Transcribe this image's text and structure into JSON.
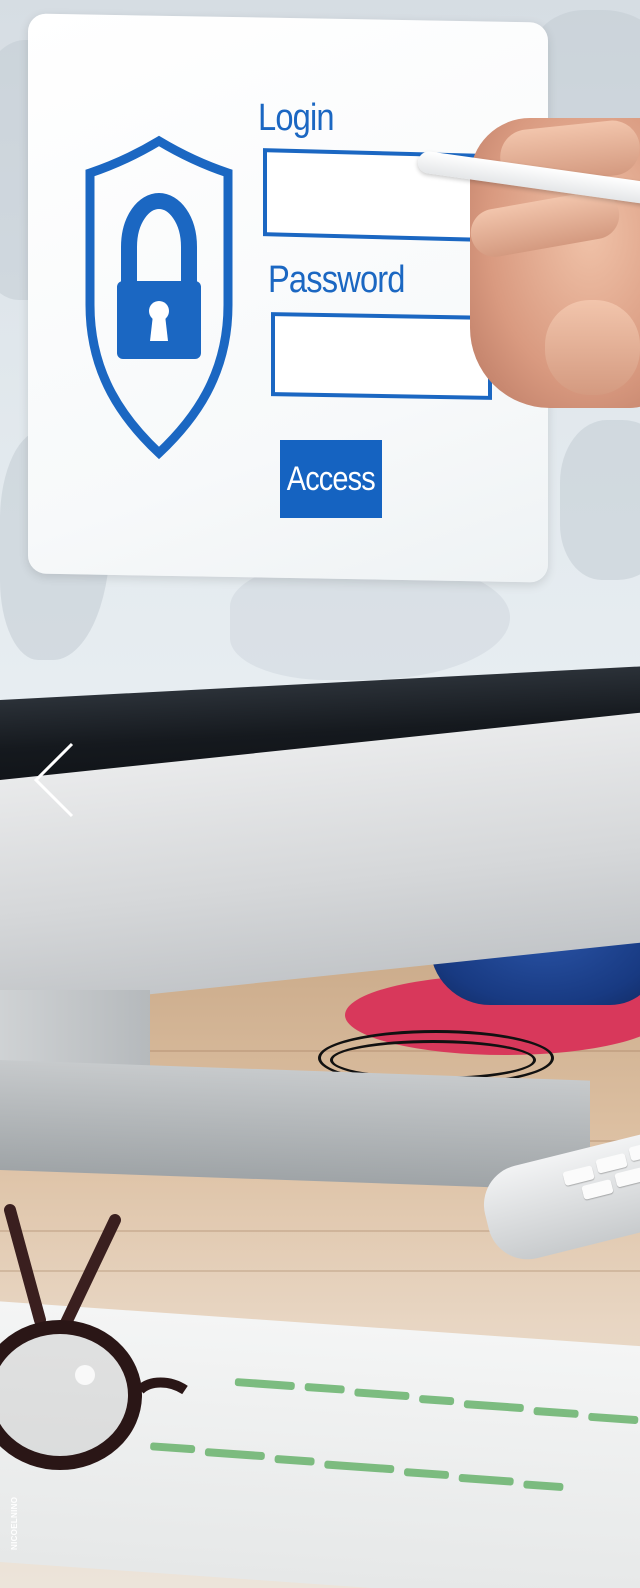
{
  "login_form": {
    "login_label": "Login",
    "password_label": "Password",
    "access_button": "Access"
  },
  "navigation": {
    "previous_icon": "chevron-left-icon"
  },
  "photo_credit": "NICOELNINO",
  "colors": {
    "brand_blue": "#1b67c2",
    "button_blue": "#1563c1",
    "card_white": "#ffffff",
    "coaster_pink": "#d8385b",
    "mug_blue": "#183a82"
  }
}
